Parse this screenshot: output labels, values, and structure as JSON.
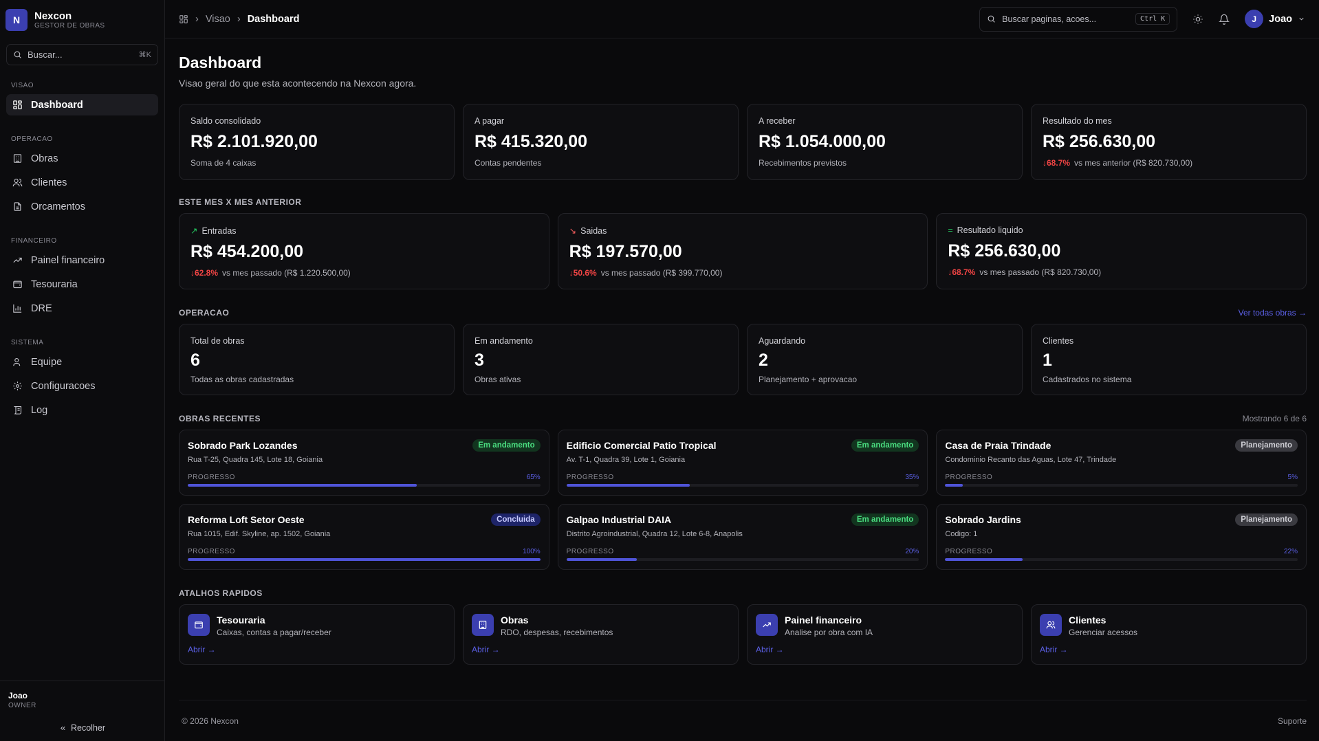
{
  "brand": {
    "name": "Nexcon",
    "subtitle": "GESTOR DE OBRAS",
    "logo_letter": "N"
  },
  "sidebar": {
    "search_placeholder": "Buscar...",
    "search_shortcut": "⌘K",
    "sections": [
      {
        "title": "VISAO",
        "items": [
          {
            "label": "Dashboard",
            "icon": "grid-icon",
            "active": true
          }
        ]
      },
      {
        "title": "OPERACAO",
        "items": [
          {
            "label": "Obras",
            "icon": "building-icon"
          },
          {
            "label": "Clientes",
            "icon": "users-icon"
          },
          {
            "label": "Orcamentos",
            "icon": "file-icon"
          }
        ]
      },
      {
        "title": "FINANCEIRO",
        "items": [
          {
            "label": "Painel financeiro",
            "icon": "trending-up-icon"
          },
          {
            "label": "Tesouraria",
            "icon": "wallet-icon"
          },
          {
            "label": "DRE",
            "icon": "bar-chart-icon"
          }
        ]
      },
      {
        "title": "SISTEMA",
        "items": [
          {
            "label": "Equipe",
            "icon": "user-icon"
          },
          {
            "label": "Configuracoes",
            "icon": "gear-icon"
          },
          {
            "label": "Log",
            "icon": "log-icon"
          }
        ]
      }
    ],
    "user": {
      "name": "Joao",
      "role": "OWNER"
    },
    "collapse_label": "Recolher"
  },
  "topbar": {
    "breadcrumb": [
      "Visao",
      "Dashboard"
    ],
    "search_placeholder": "Buscar paginas, acoes...",
    "search_shortcut": "Ctrl K",
    "user": {
      "name": "Joao",
      "initial": "J"
    }
  },
  "page": {
    "title": "Dashboard",
    "subtitle": "Visao geral do que esta acontecendo na Nexcon agora."
  },
  "kpis": [
    {
      "label": "Saldo consolidado",
      "value": "R$ 2.101.920,00",
      "hint": "Soma de 4 caixas",
      "color": "#ffffff"
    },
    {
      "label": "A pagar",
      "value": "R$ 415.320,00",
      "hint": "Contas pendentes",
      "color": "#f25c5c"
    },
    {
      "label": "A receber",
      "value": "R$ 1.054.000,00",
      "hint": "Recebimentos previstos",
      "color": "#f5c518"
    },
    {
      "label": "Resultado do mes",
      "value": "R$ 256.630,00",
      "delta": "68.7%",
      "hint": "vs mes anterior (R$ 820.730,00)",
      "color": "#22c55e"
    }
  ],
  "comparison": {
    "title": "ESTE MES X MES ANTERIOR",
    "cards": [
      {
        "label": "Entradas",
        "symbol": "↗",
        "value": "R$ 454.200,00",
        "delta": "62.8%",
        "hint": "vs mes passado (R$ 1.220.500,00)",
        "color": "#22c55e"
      },
      {
        "label": "Saidas",
        "symbol": "↘",
        "value": "R$ 197.570,00",
        "delta": "50.6%",
        "hint": "vs mes passado (R$ 399.770,00)",
        "color": "#f25c5c"
      },
      {
        "label": "Resultado liquido",
        "symbol": "=",
        "value": "R$ 256.630,00",
        "delta": "68.7%",
        "hint": "vs mes passado (R$ 820.730,00)",
        "color": "#22c55e"
      }
    ]
  },
  "operacao": {
    "title": "OPERACAO",
    "link": "Ver todas obras →",
    "cards": [
      {
        "label": "Total de obras",
        "value": "6",
        "hint": "Todas as obras cadastradas"
      },
      {
        "label": "Em andamento",
        "value": "3",
        "hint": "Obras ativas"
      },
      {
        "label": "Aguardando",
        "value": "2",
        "hint": "Planejamento + aprovacao"
      },
      {
        "label": "Clientes",
        "value": "1",
        "hint": "Cadastrados no sistema"
      }
    ]
  },
  "obras": {
    "title": "OBRAS RECENTES",
    "count_text": "Mostrando 6 de 6",
    "progress_label": "PROGRESSO",
    "items": [
      {
        "name": "Sobrado Park Lozandes",
        "address": "Rua T-25, Quadra 145, Lote 18, Goiania",
        "status": "Em andamento",
        "status_type": "and",
        "progress": 65,
        "progress_text": "65%"
      },
      {
        "name": "Edificio Comercial Patio Tropical",
        "address": "Av. T-1, Quadra 39, Lote 1, Goiania",
        "status": "Em andamento",
        "status_type": "and",
        "progress": 35,
        "progress_text": "35%"
      },
      {
        "name": "Casa de Praia Trindade",
        "address": "Condominio Recanto das Aguas, Lote 47, Trindade",
        "status": "Planejamento",
        "status_type": "plan",
        "progress": 5,
        "progress_text": "5%"
      },
      {
        "name": "Reforma Loft Setor Oeste",
        "address": "Rua 1015, Edif. Skyline, ap. 1502, Goiania",
        "status": "Concluida",
        "status_type": "conc",
        "progress": 100,
        "progress_text": "100%"
      },
      {
        "name": "Galpao Industrial DAIA",
        "address": "Distrito Agroindustrial, Quadra 12, Lote 6-8, Anapolis",
        "status": "Em andamento",
        "status_type": "and",
        "progress": 20,
        "progress_text": "20%"
      },
      {
        "name": "Sobrado Jardins",
        "address": "Codigo: 1",
        "status": "Planejamento",
        "status_type": "plan",
        "progress": 22,
        "progress_text": "22%"
      }
    ]
  },
  "atalhos": {
    "title": "ATALHOS RAPIDOS",
    "items": [
      {
        "name": "Tesouraria",
        "desc": "Caixas, contas a pagar/receber",
        "link": "Abrir →",
        "icon": "wallet-icon"
      },
      {
        "name": "Obras",
        "desc": "RDO, despesas, recebimentos",
        "link": "Abrir →",
        "icon": "building-icon"
      },
      {
        "name": "Painel financeiro",
        "desc": "Analise por obra com IA",
        "link": "Abrir →",
        "icon": "trending-up-icon"
      },
      {
        "name": "Clientes",
        "desc": "Gerenciar acessos",
        "link": "Abrir →",
        "icon": "users-icon"
      }
    ]
  },
  "footer": {
    "copyright": "© 2026 Nexcon",
    "support": "Suporte"
  }
}
